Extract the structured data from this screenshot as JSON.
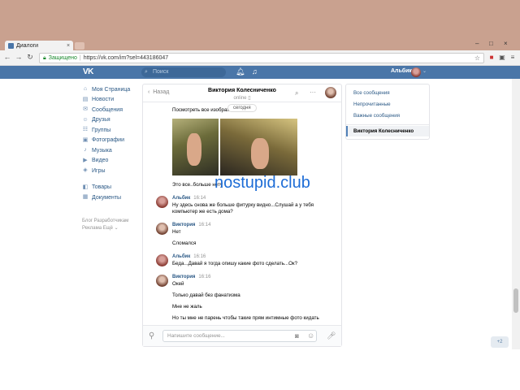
{
  "browser": {
    "tab_title": "Диалоги",
    "tab_close": "×",
    "url_secure_label": "Защищено",
    "url": "https://vk.com/im?sel=443186047",
    "window_controls": [
      "–",
      "□",
      "×"
    ]
  },
  "vk_header": {
    "logo": "VK",
    "search_placeholder": "Поиск",
    "user_name": "Альбик"
  },
  "sidebar": {
    "items": [
      {
        "label": "Моя Страница",
        "icon": "home-icon"
      },
      {
        "label": "Новости",
        "icon": "news-icon"
      },
      {
        "label": "Сообщения",
        "icon": "messages-icon"
      },
      {
        "label": "Друзья",
        "icon": "friends-icon"
      },
      {
        "label": "Группы",
        "icon": "groups-icon"
      },
      {
        "label": "Фотографии",
        "icon": "photos-icon"
      },
      {
        "label": "Музыка",
        "icon": "music-icon"
      },
      {
        "label": "Видео",
        "icon": "video-icon"
      },
      {
        "label": "Игры",
        "icon": "games-icon"
      }
    ],
    "items2": [
      {
        "label": "Товары",
        "icon": "goods-icon"
      },
      {
        "label": "Документы",
        "icon": "documents-icon"
      }
    ],
    "footer_line1": "Блог   Разработчикам",
    "footer_line2": "Реклама   Ещё ⌄"
  },
  "dialog": {
    "back_label": "Назад",
    "contact_name": "Виктория Колесниченко",
    "status": "online",
    "date_pill": "сегодня",
    "first_text": "Посмотреть все изображ...",
    "after_photos_text": "Это все..больше нету",
    "messages": [
      {
        "author": "Альбик",
        "time": "16:14",
        "lines": [
          "Ну здесь снова же больше фитурку видно...Слушай а у тебя",
          "компьютер же есть дома?"
        ]
      },
      {
        "author": "Виктория",
        "time": "16:14",
        "lines": [
          "Нет",
          "",
          "Сломался"
        ]
      },
      {
        "author": "Альбик",
        "time": "16:16",
        "lines": [
          "Беда...Давай я тогда опишу какие фото сделать...Ок?"
        ]
      },
      {
        "author": "Виктория",
        "time": "16:16",
        "lines": [
          "Окей",
          "",
          "Только давай без фанатизма",
          "",
          "Мне не жаль",
          "",
          "Но ты мне не парень чтобы такие прям интимные фото кидать"
        ]
      }
    ],
    "compose_placeholder": "Напишите сообщение..."
  },
  "folders": {
    "items": [
      "Все сообщения",
      "Непрочитанные",
      "Важные сообщения"
    ],
    "selected": "Виктория Колесниченко"
  },
  "watermark": "nostupid.club",
  "fab_label": "+2",
  "colors": {
    "vk_blue": "#4a76a8",
    "link": "#2a5885",
    "watermark": "#1e6dd6"
  }
}
